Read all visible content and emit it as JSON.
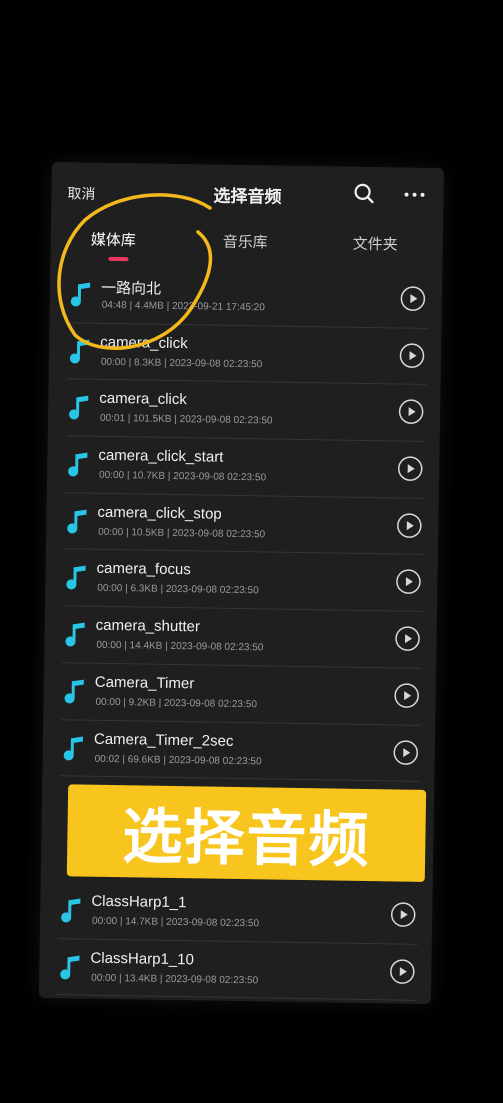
{
  "header": {
    "cancel_label": "取消",
    "title": "选择音频"
  },
  "tabs": [
    {
      "label": "媒体库",
      "active": true
    },
    {
      "label": "音乐库",
      "active": false
    },
    {
      "label": "文件夹",
      "active": false
    }
  ],
  "items": [
    {
      "name": "一路向北",
      "meta": "04:48 | 4.4MB | 2023-09-21 17:45:20"
    },
    {
      "name": "camera_click",
      "meta": "00:00 | 8.3KB | 2023-09-08 02:23:50"
    },
    {
      "name": "camera_click",
      "meta": "00:01 | 101.5KB | 2023-09-08 02:23:50"
    },
    {
      "name": "camera_click_start",
      "meta": "00:00 | 10.7KB | 2023-09-08 02:23:50"
    },
    {
      "name": "camera_click_stop",
      "meta": "00:00 | 10.5KB | 2023-09-08 02:23:50"
    },
    {
      "name": "camera_focus",
      "meta": "00:00 | 6.3KB | 2023-09-08 02:23:50"
    },
    {
      "name": "camera_shutter",
      "meta": "00:00 | 14.4KB | 2023-09-08 02:23:50"
    },
    {
      "name": "Camera_Timer",
      "meta": "00:00 | 9.2KB | 2023-09-08 02:23:50"
    },
    {
      "name": "Camera_Timer_2sec",
      "meta": "00:02 | 69.6KB | 2023-09-08 02:23:50"
    }
  ],
  "items_after_banner": [
    {
      "name": "ClassHarp1_1",
      "meta": "00:00 | 14.7KB | 2023-09-08 02:23:50"
    },
    {
      "name": "ClassHarp1_10",
      "meta": "00:00 | 13.4KB | 2023-09-08 02:23:50"
    }
  ],
  "banner": {
    "text": "选择音频"
  },
  "colors": {
    "accent_note": "#29c5e6",
    "tab_indicator": "#e8365c",
    "banner_bg": "#f7c51e",
    "annotation_circle": "#f2b81c"
  },
  "icons": {
    "search": "search-icon",
    "more": "more-dots-icon",
    "note": "music-note-icon",
    "play": "play-icon"
  }
}
